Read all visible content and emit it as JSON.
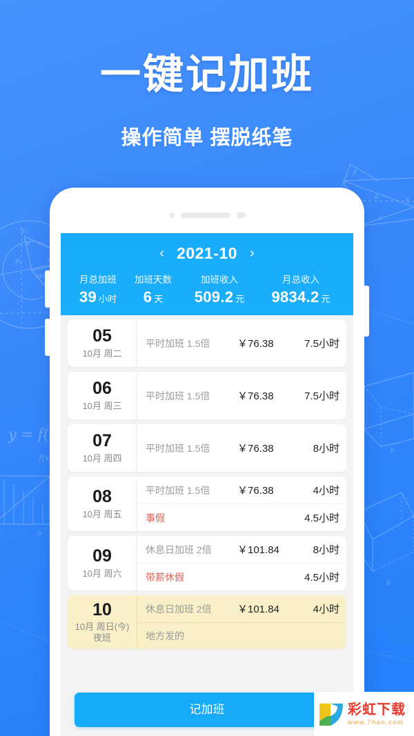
{
  "promo": {
    "title": "一键记加班",
    "subtitle": "操作简单 摆脱纸笔"
  },
  "colors": {
    "page_background": "#3A8AFB",
    "app_header": "#17ABFA",
    "cta": "#16ABF8",
    "today_highlight": "#FAF0C8",
    "leave_text": "#E06054",
    "watermark_brand": "#E8392C"
  },
  "app": {
    "header": {
      "prev_label": "‹",
      "month": "2021-10",
      "next_label": "›",
      "stats": [
        {
          "label": "月总加班",
          "value": "39",
          "unit": "小时"
        },
        {
          "label": "加班天数",
          "value": "6",
          "unit": "天"
        },
        {
          "label": "加班收入",
          "value": "509.2",
          "unit": "元"
        },
        {
          "label": "月总收入",
          "value": "9834.2",
          "unit": "元"
        }
      ]
    },
    "rows": [
      {
        "day": "05",
        "sub": "10月 周二",
        "shift": "",
        "today": false,
        "entries": [
          {
            "type": "平时加班 1.5倍",
            "amount": "￥76.38",
            "hours": "7.5小时",
            "leave": false
          }
        ]
      },
      {
        "day": "06",
        "sub": "10月 周三",
        "shift": "",
        "today": false,
        "entries": [
          {
            "type": "平时加班 1.5倍",
            "amount": "￥76.38",
            "hours": "7.5小时",
            "leave": false
          }
        ]
      },
      {
        "day": "07",
        "sub": "10月 周四",
        "shift": "",
        "today": false,
        "entries": [
          {
            "type": "平时加班 1.5倍",
            "amount": "￥76.38",
            "hours": "8小时",
            "leave": false
          }
        ]
      },
      {
        "day": "08",
        "sub": "10月 周五",
        "shift": "",
        "today": false,
        "entries": [
          {
            "type": "平时加班 1.5倍",
            "amount": "￥76.38",
            "hours": "4小时",
            "leave": false
          },
          {
            "type": "事假",
            "amount": "",
            "hours": "4.5小时",
            "leave": true
          }
        ]
      },
      {
        "day": "09",
        "sub": "10月 周六",
        "shift": "",
        "today": false,
        "entries": [
          {
            "type": "休息日加班 2倍",
            "amount": "￥101.84",
            "hours": "8小时",
            "leave": false
          },
          {
            "type": "带薪休假",
            "amount": "",
            "hours": "4.5小时",
            "leave": true
          }
        ]
      },
      {
        "day": "10",
        "sub": "10月 周日(今)",
        "shift": "夜班",
        "today": true,
        "entries": [
          {
            "type": "休息日加班 2倍",
            "amount": "￥101.84",
            "hours": "4小时",
            "leave": false
          },
          {
            "type": "地方发的",
            "amount": "",
            "hours": "",
            "leave": false
          }
        ]
      }
    ],
    "cta_label": "记加班"
  },
  "watermark": {
    "brand": "彩虹下载",
    "url": "www.7han.com"
  }
}
